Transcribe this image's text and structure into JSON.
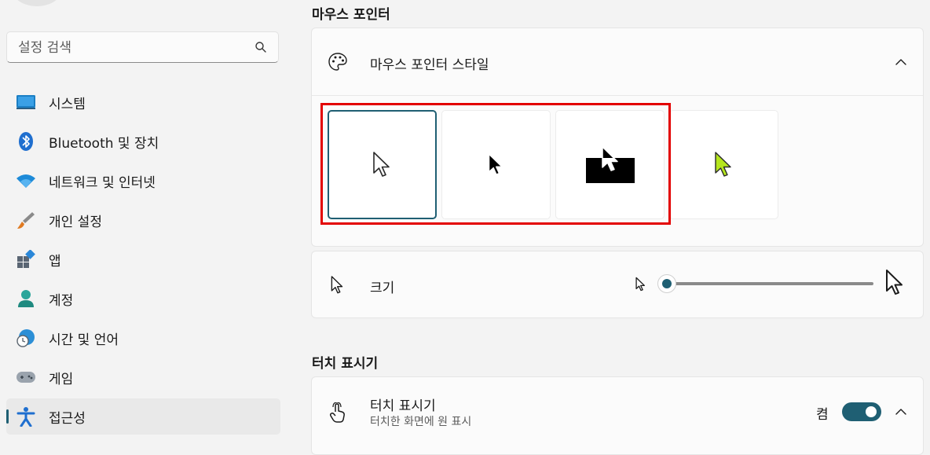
{
  "sidebar": {
    "search": {
      "placeholder": "설정 검색",
      "icon": "search-icon"
    },
    "items": [
      {
        "label": "시스템",
        "icon": "system-monitor-icon"
      },
      {
        "label": "Bluetooth 및 장치",
        "icon": "bluetooth-icon"
      },
      {
        "label": "네트워크 및 인터넷",
        "icon": "wifi-icon"
      },
      {
        "label": "개인 설정",
        "icon": "paintbrush-icon"
      },
      {
        "label": "앱",
        "icon": "apps-icon"
      },
      {
        "label": "계정",
        "icon": "person-icon"
      },
      {
        "label": "시간 및 언어",
        "icon": "globe-clock-icon"
      },
      {
        "label": "게임",
        "icon": "gamepad-icon"
      },
      {
        "label": "접근성",
        "icon": "accessibility-icon",
        "selected": true
      }
    ]
  },
  "main": {
    "pointer_section_title": "마우스 포인터",
    "pointer_style": {
      "label": "마우스 포인터 스타일",
      "icon": "palette-icon",
      "expanded": true,
      "options": [
        {
          "name": "white",
          "selected": true
        },
        {
          "name": "black",
          "selected": false
        },
        {
          "name": "inverted",
          "selected": false
        },
        {
          "name": "custom",
          "color": "#b5e61d",
          "selected": false
        }
      ]
    },
    "size": {
      "label": "크기",
      "icon": "pointer-icon",
      "slider_value_fraction": 0.0
    },
    "touch_section_title": "터치 표시기",
    "touch_indicator": {
      "label": "터치 표시기",
      "description": "터치한 화면에 원 표시",
      "icon": "touch-hand-icon",
      "toggle_text": "켬",
      "toggle_on": true
    }
  },
  "colors": {
    "accent": "#1f5f73",
    "highlight_box": "#e30000",
    "custom_pointer": "#b5e61d"
  }
}
